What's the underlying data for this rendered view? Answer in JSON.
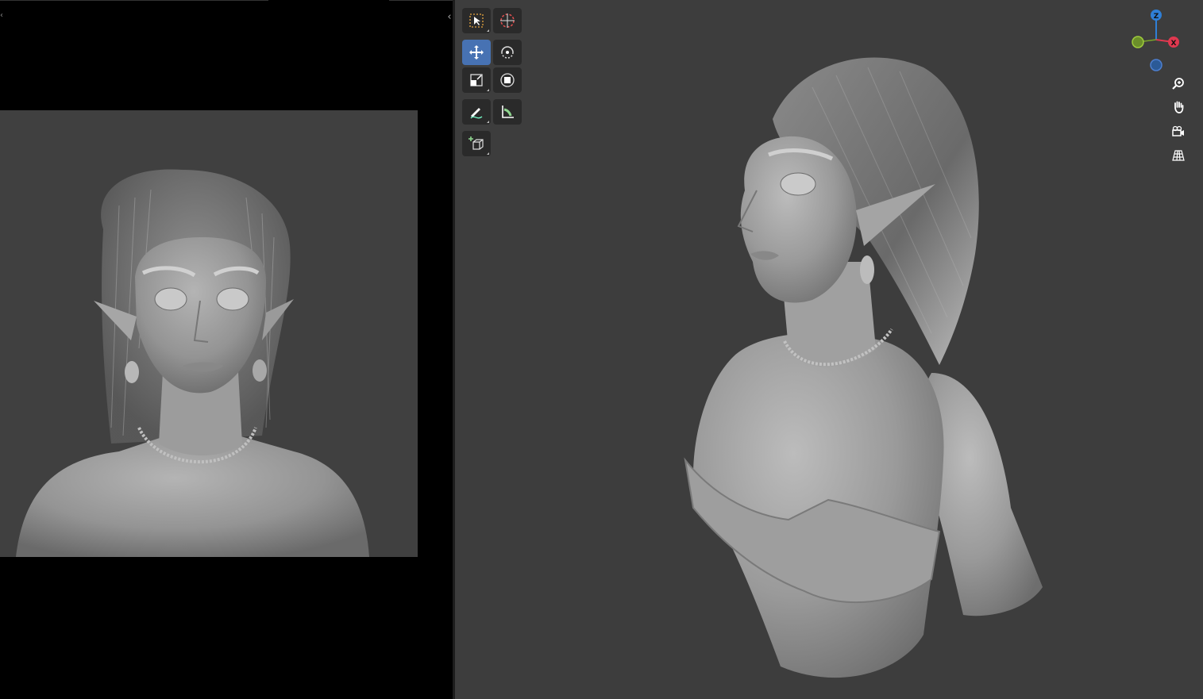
{
  "image_editor": {
    "collapse_left_glyph": "‹",
    "collapse_right_glyph": "‹",
    "reference_image": "front-view-elf-bust-sculpt"
  },
  "viewport": {
    "scene": "three-quarter-view-elf-bust-sculpt",
    "toolbar": [
      {
        "name": "select-box-tool",
        "icon": "select-box-icon",
        "active": false
      },
      {
        "name": "cursor-tool",
        "icon": "cursor-icon",
        "active": false
      },
      {
        "name": "move-tool",
        "icon": "move-icon",
        "active": true
      },
      {
        "name": "rotate-tool",
        "icon": "rotate-icon",
        "active": false
      },
      {
        "name": "scale-tool",
        "icon": "scale-icon",
        "active": false
      },
      {
        "name": "transform-tool",
        "icon": "transform-icon",
        "active": false
      },
      {
        "name": "annotate-tool",
        "icon": "annotate-icon",
        "active": false
      },
      {
        "name": "measure-tool",
        "icon": "measure-icon",
        "active": false
      },
      {
        "name": "add-cube-tool",
        "icon": "add-cube-icon",
        "active": false
      }
    ],
    "gizmo": {
      "z_label": "Z",
      "x_label": "X",
      "colors": {
        "z": "#2f7fd6",
        "x": "#e0384f",
        "y": "#7aa52a",
        "neg_z": "#2b5a97"
      }
    },
    "nav_buttons": [
      "zoom-icon",
      "pan-hand-icon",
      "camera-icon",
      "perspective-grid-icon"
    ],
    "colors": {
      "active_tool": "#4772b3",
      "tool_bg": "#2a2a2a",
      "viewport_bg": "#3d3d3d",
      "image_bg": "#404040"
    }
  }
}
